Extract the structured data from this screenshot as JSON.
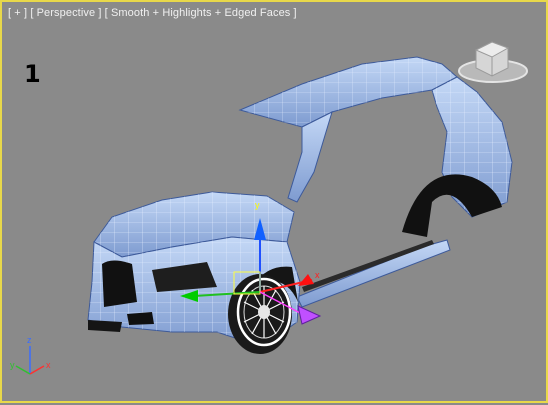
{
  "viewport": {
    "label_parts": [
      "[ + ]",
      "[ Perspective ]",
      "[ Smooth + Highlights + Edged Faces ]"
    ],
    "active_border_color": "#e8d84a",
    "background_color": "#8a8a8a"
  },
  "overlay": {
    "shot_number": "1"
  },
  "viewcube": {
    "icon": "viewcube-icon"
  },
  "axis_tripod": {
    "x_label": "x",
    "y_label": "y",
    "z_label": "z"
  },
  "gizmo": {
    "icon": "transform-gizmo-icon",
    "x_label": "x",
    "y_label": "y"
  },
  "model": {
    "name": "car-body-mesh",
    "mesh_color": "#a8c4f0",
    "wire_color": "#e8f0ff"
  }
}
